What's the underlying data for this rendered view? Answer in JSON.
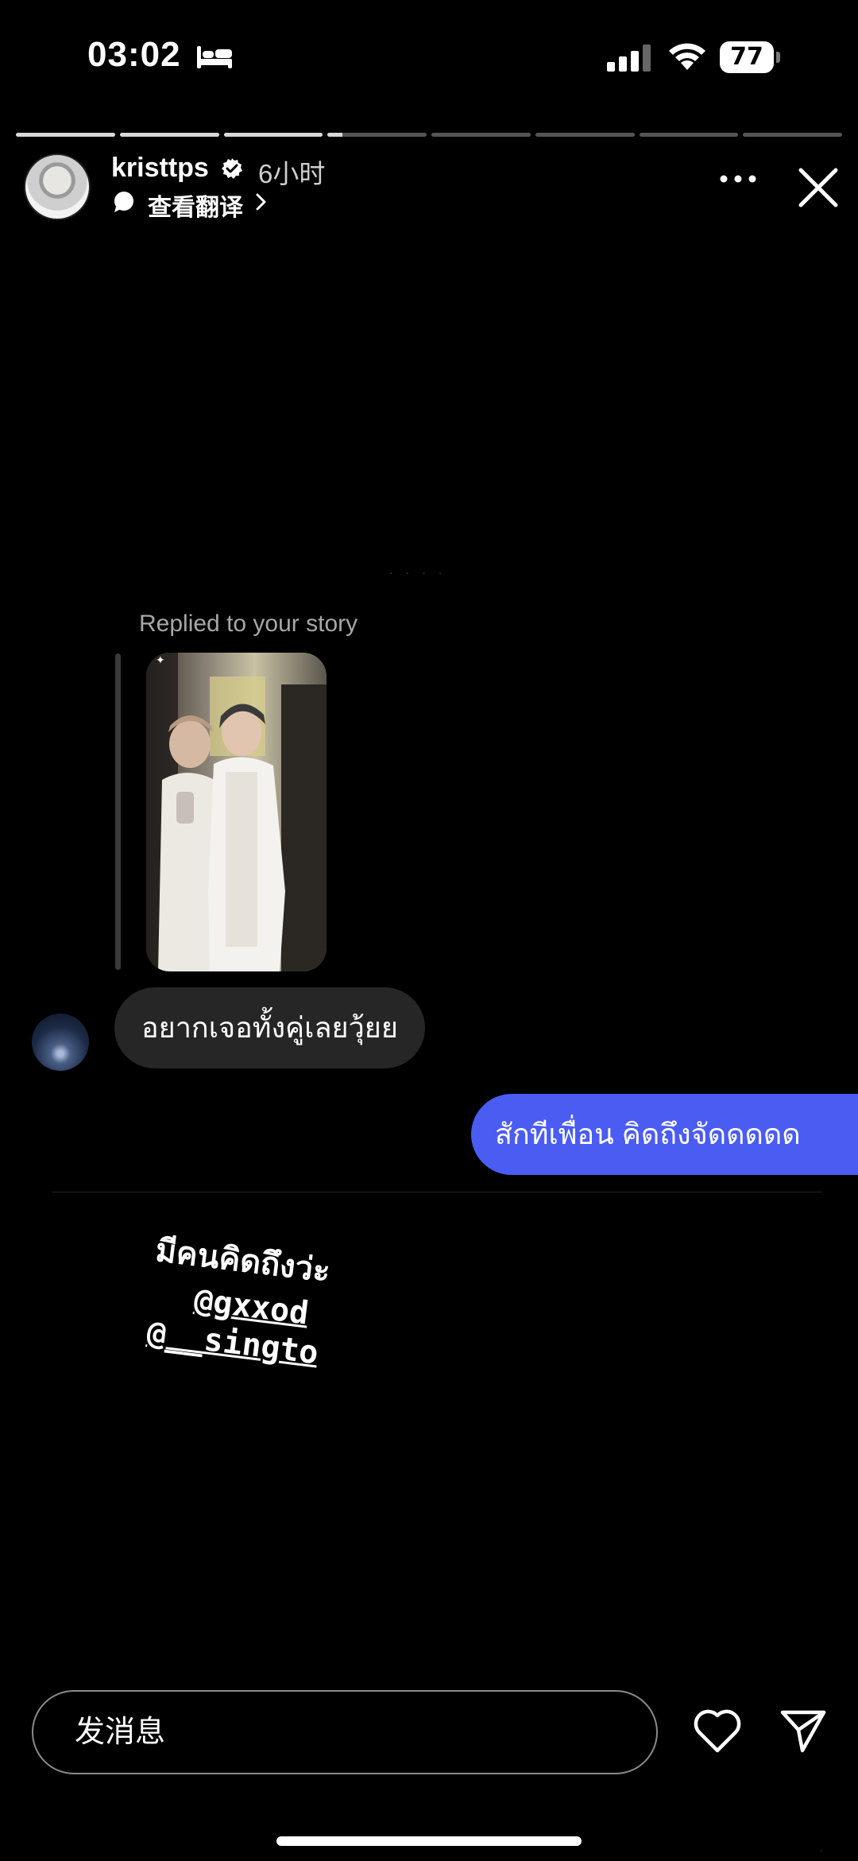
{
  "status_bar": {
    "time": "03:02",
    "battery": "77",
    "icons": [
      "bed-icon",
      "signal-icon",
      "wifi-icon",
      "battery-icon"
    ]
  },
  "progress": {
    "segments": [
      1,
      1,
      1,
      0.15,
      0,
      0,
      0,
      0
    ],
    "colors": {
      "filled": "#d8d8d8",
      "track": "#555555"
    }
  },
  "header": {
    "username": "kristtps",
    "verified": true,
    "time_ago": "6小时",
    "translate": "查看翻译"
  },
  "story": {
    "reply_label": "Replied to your story",
    "incoming_message": "อยากเจอทั้งคู่เลยวุ้ยย",
    "outgoing_message": "สักทีเพื่อน คิดถึงจัดดดดด",
    "caption_line1": "มีคนคิดถึงว่ะ",
    "caption_mention1": "@gxxod",
    "caption_mention2": "@__singto",
    "colors": {
      "outgoing_bubble": "#4a5cf2",
      "incoming_bubble": "#262626"
    }
  },
  "footer": {
    "message_placeholder": "发消息",
    "icons": [
      "heart-icon",
      "send-icon"
    ]
  }
}
